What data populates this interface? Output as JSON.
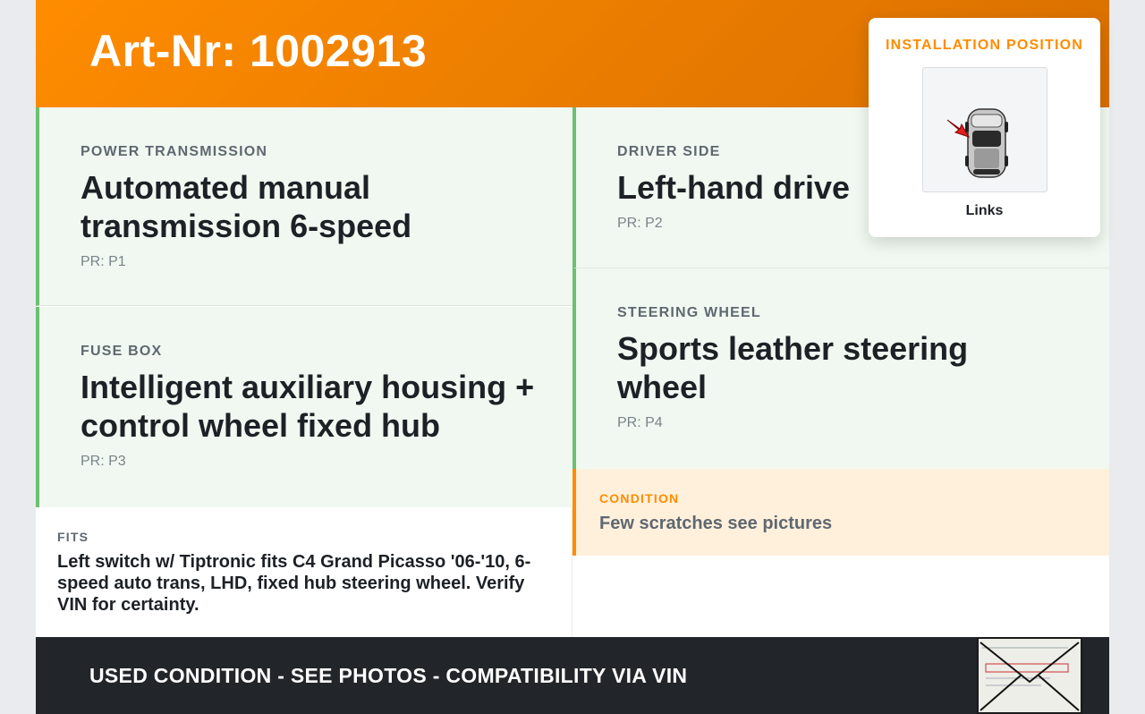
{
  "header": {
    "art_nr": "Art-Nr: 1002913"
  },
  "details": [
    {
      "label": "POWER TRANSMISSION",
      "value": "Automated manual transmission 6-speed",
      "pr": "PR: P1"
    },
    {
      "label": "DRIVER SIDE",
      "value": "Left-hand drive",
      "pr": "PR: P2"
    },
    {
      "label": "FUSE BOX",
      "value": "Intelligent auxiliary housing + control wheel fixed hub",
      "pr": "PR: P3"
    },
    {
      "label": "STEERING WHEEL",
      "value": "Sports leather steering wheel",
      "pr": "PR: P4"
    }
  ],
  "fits": {
    "label": "FITS",
    "text": "Left switch w/ Tiptronic fits C4 Grand Picasso '06-'10, 6-speed auto trans, LHD, fixed hub steering wheel. Verify VIN for certainty."
  },
  "condition": {
    "label": "CONDITION",
    "text": "Few scratches see pictures"
  },
  "footer": {
    "text": "USED CONDITION - SEE PHOTOS - COMPATIBILITY VIA VIN"
  },
  "installation": {
    "title": "INSTALLATION POSITION",
    "caption": "Links",
    "image_icon": "car-top-view-icon",
    "arrow_icon": "red-arrow-icon"
  },
  "colors": {
    "accent_orange": "#ff8c00",
    "accent_green": "#6cc070",
    "panel_green": "#f1f8f1",
    "panel_orange": "#fff0dc",
    "footer_dark": "#22252a"
  }
}
